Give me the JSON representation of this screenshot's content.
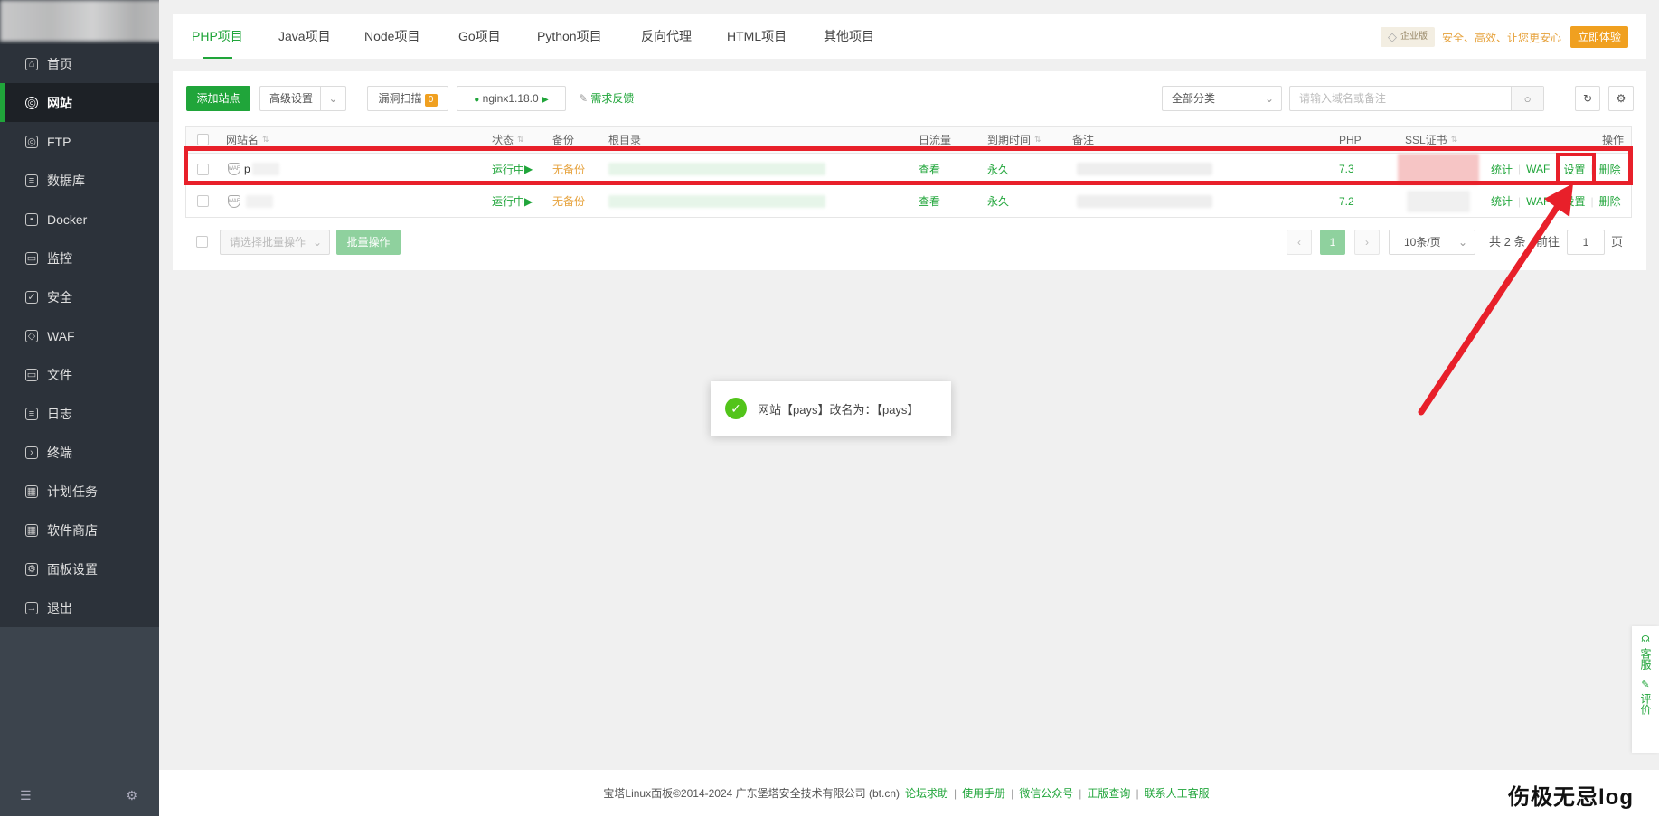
{
  "sidebar": {
    "items": [
      {
        "label": "首页",
        "icon": "home-icon"
      },
      {
        "label": "网站",
        "icon": "globe-icon",
        "active": true
      },
      {
        "label": "FTP",
        "icon": "ftp-icon"
      },
      {
        "label": "数据库",
        "icon": "database-icon"
      },
      {
        "label": "Docker",
        "icon": "docker-icon"
      },
      {
        "label": "监控",
        "icon": "monitor-icon"
      },
      {
        "label": "安全",
        "icon": "shield-icon"
      },
      {
        "label": "WAF",
        "icon": "waf-icon"
      },
      {
        "label": "文件",
        "icon": "folder-icon"
      },
      {
        "label": "日志",
        "icon": "log-icon"
      },
      {
        "label": "终端",
        "icon": "terminal-icon"
      },
      {
        "label": "计划任务",
        "icon": "calendar-icon"
      },
      {
        "label": "软件商店",
        "icon": "apps-icon"
      },
      {
        "label": "面板设置",
        "icon": "gear-icon"
      },
      {
        "label": "退出",
        "icon": "logout-icon"
      }
    ]
  },
  "tabs": [
    "PHP项目",
    "Java项目",
    "Node项目",
    "Go项目",
    "Python项目",
    "反向代理",
    "HTML项目",
    "其他项目"
  ],
  "enterprise": {
    "badge": "企业版",
    "slogan": "安全、高效、让您更安心",
    "cta": "立即体验"
  },
  "toolbar": {
    "add_site": "添加站点",
    "advanced": "高级设置",
    "vuln_scan": "漏洞扫描",
    "vuln_count": "0",
    "nginx": "nginx1.18.0",
    "feedback": "需求反馈",
    "category": "全部分类",
    "search_placeholder": "请输入域名或备注"
  },
  "table": {
    "headers": {
      "name": "网站名",
      "status": "状态",
      "backup": "备份",
      "root": "根目录",
      "traffic": "日流量",
      "expire": "到期时间",
      "note": "备注",
      "php": "PHP",
      "ssl": "SSL证书",
      "ops": "操作"
    },
    "rows": [
      {
        "name": "p",
        "status": "运行中",
        "backup": "无备份",
        "traffic": "查看",
        "expire": "永久",
        "php": "7.3"
      },
      {
        "name": "",
        "status": "运行中",
        "backup": "无备份",
        "traffic": "查看",
        "expire": "永久",
        "php": "7.2"
      }
    ],
    "ops": {
      "stats": "统计",
      "waf": "WAF",
      "settings": "设置",
      "delete": "删除"
    }
  },
  "batch": {
    "select_placeholder": "请选择批量操作",
    "action": "批量操作"
  },
  "pagination": {
    "current": "1",
    "page_size": "10条/页",
    "total": "共 2 条",
    "goto": "前往",
    "goto_value": "1",
    "page_unit": "页"
  },
  "toast": {
    "message": "网站【pays】改名为：【pays】"
  },
  "float": {
    "service": "客服",
    "review": "评价"
  },
  "footer": {
    "copyright": "宝塔Linux面板©2014-2024 广东堡塔安全技术有限公司 (bt.cn)",
    "links": [
      "论坛求助",
      "使用手册",
      "微信公众号",
      "正版查询",
      "联系人工客服"
    ]
  },
  "watermark": "伤极无忌log",
  "colors": {
    "accent": "#20a53a",
    "annotation": "#e8202a",
    "sidebar": "#3c444d"
  }
}
